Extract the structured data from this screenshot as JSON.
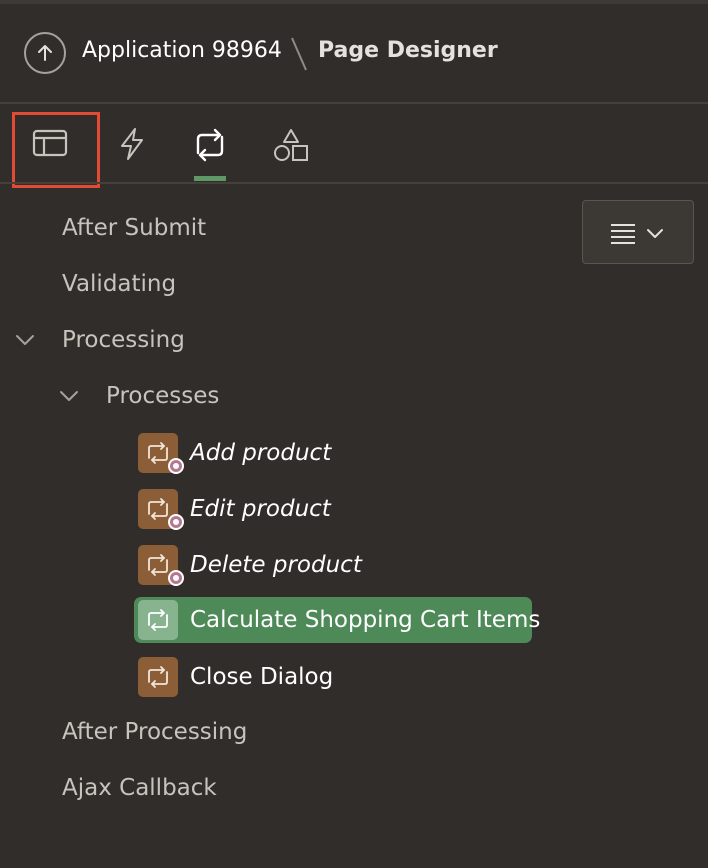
{
  "header": {
    "app_title": "Application 98964",
    "page_title": "Page Designer",
    "back_icon": "arrow-up-circle-icon"
  },
  "toolbar": {
    "tabs": [
      {
        "icon": "layout-panel-icon",
        "highlighted": true
      },
      {
        "icon": "lightning-bolt-icon"
      },
      {
        "icon": "process-loop-icon",
        "active": true
      },
      {
        "icon": "shapes-icon"
      }
    ],
    "menu_icon": "hamburger-menu-icon",
    "menu_chevron": "chevron-down-icon"
  },
  "tree": {
    "after_submit": "After Submit",
    "validating": "Validating",
    "processing": "Processing",
    "processes": "Processes",
    "items": [
      {
        "label": "Add product",
        "italic": true,
        "conditional": true
      },
      {
        "label": "Edit product",
        "italic": true,
        "conditional": true
      },
      {
        "label": "Delete product",
        "italic": true,
        "conditional": true
      },
      {
        "label": "Calculate Shopping Cart Items",
        "selected": true
      },
      {
        "label": "Close Dialog"
      }
    ],
    "after_processing": "After Processing",
    "ajax_callback": "Ajax Callback"
  },
  "colors": {
    "background": "#312d2a",
    "selected": "#4d8a58",
    "process_icon": "#8b5e38",
    "highlight_border": "#e24a33",
    "active_tab": "#5f9767"
  }
}
